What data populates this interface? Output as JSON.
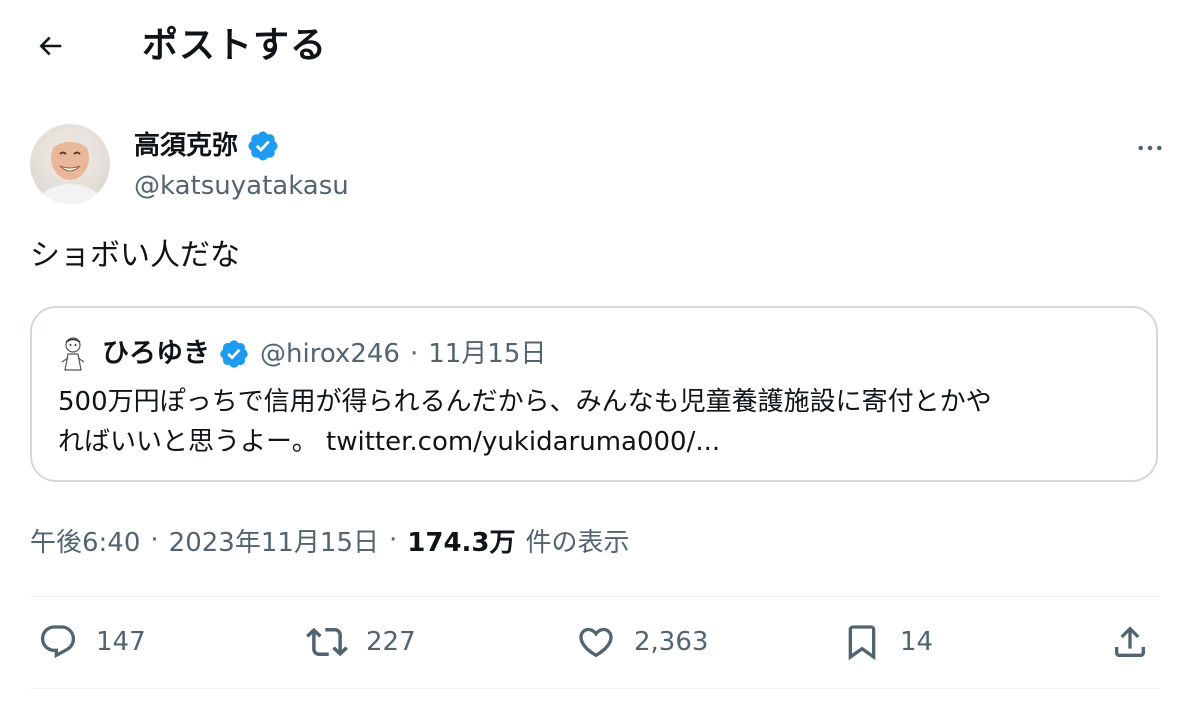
{
  "header": {
    "title": "ポストする",
    "back_icon": "arrow-left-icon"
  },
  "author": {
    "display_name": "高須克弥",
    "handle": "@katsuyatakasu",
    "verified": true
  },
  "tweet": {
    "text": "ショボい人だな"
  },
  "quote": {
    "display_name": "ひろゆき",
    "handle": "@hirox246",
    "separator": "·",
    "date": "11月15日",
    "verified": true,
    "line1": "500万円ぽっちで信用が得られるんだから、みんなも児童養護施設に寄付とかや",
    "line2_text": "ればいいと思うよー。 ",
    "link": "twitter.com/yukidaruma000/..."
  },
  "meta": {
    "time": "午後6:40",
    "separator1": "·",
    "date": "2023年11月15日",
    "separator2": "·",
    "views_count": "174.3万",
    "views_label": "件の表示"
  },
  "actions": {
    "reply_count": "147",
    "repost_count": "227",
    "like_count": "2,363",
    "bookmark_count": "14"
  },
  "colors": {
    "text_primary": "#0f1419",
    "text_secondary": "#536471",
    "verified_blue": "#1d9bf0",
    "border": "#cfd9de",
    "divider": "#eff3f4"
  }
}
